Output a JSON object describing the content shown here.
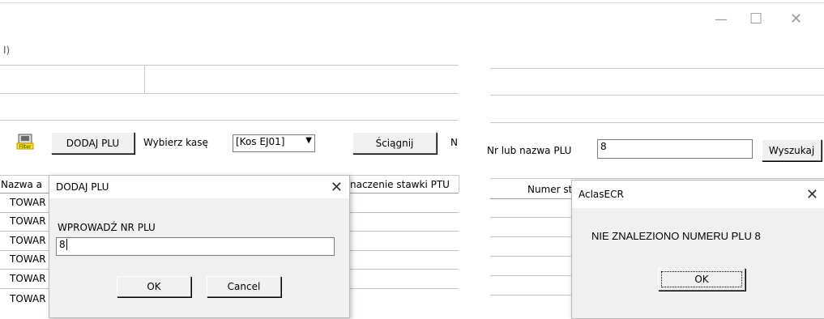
{
  "window": {
    "minimize": "—",
    "maximize": "☐",
    "close": "✕"
  },
  "top_left_fragment": "I)",
  "left_panel": {
    "filter_icon_label": "Filter",
    "add_plu_button": "DODAJ PLU",
    "select_register_label": "Wybierz kasę",
    "register_value": "[Kos EJ01]",
    "download_button": "Ściągnij",
    "cut_label": "N",
    "table": {
      "col_name": "Nazwa a",
      "col_vat": "naczenie stawki PTU",
      "rows": [
        "TOWAR",
        "TOWAR",
        "TOWAR",
        "TOWAR",
        "TOWAR",
        "TOWAR"
      ]
    },
    "dialog": {
      "title": "DODAJ PLU",
      "prompt": "WPROWADŹ NR PLU",
      "input_value": "8",
      "ok_button": "OK",
      "cancel_button": "Cancel"
    }
  },
  "right_panel": {
    "search_label": "Nr lub nazwa PLU",
    "search_value": "8",
    "search_button": "Wyszukaj",
    "table": {
      "col_number": "Numer sta"
    },
    "dialog": {
      "title": "AclasECR",
      "message": "NIE ZNALEZIONO NUMERU PLU 8",
      "ok_button": "OK"
    }
  }
}
